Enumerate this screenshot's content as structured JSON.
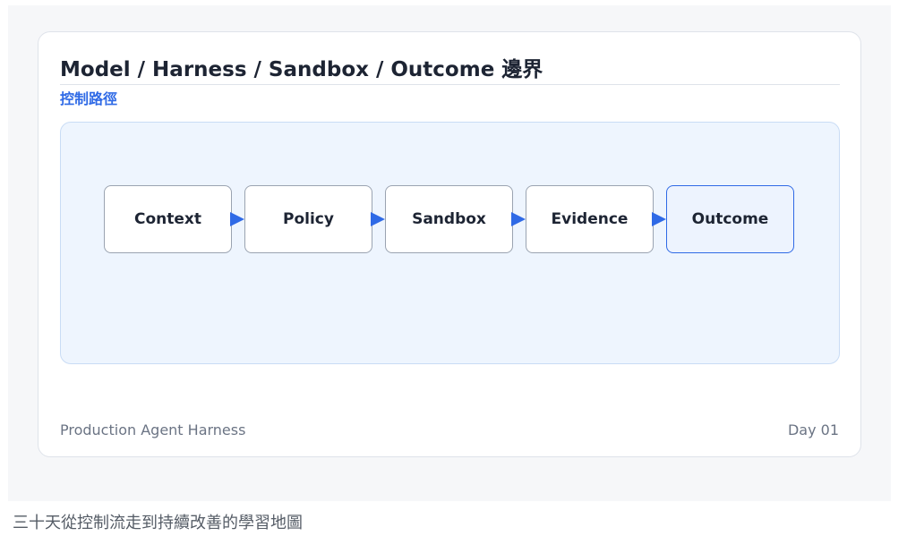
{
  "diagram": {
    "title": "Model / Harness / Sandbox / Outcome 邊界",
    "subtitle": "控制路徑",
    "nodes": [
      {
        "label": "Context",
        "highlight": false
      },
      {
        "label": "Policy",
        "highlight": false
      },
      {
        "label": "Sandbox",
        "highlight": false
      },
      {
        "label": "Evidence",
        "highlight": false
      },
      {
        "label": "Outcome",
        "highlight": true
      }
    ],
    "footer_left": "Production Agent Harness",
    "footer_right": "Day 01"
  },
  "caption": "三十天從控制流走到持續改善的學習地圖",
  "colors": {
    "accent": "#2f6ae6",
    "panel": "#eef5fe",
    "arrow": "#2f6ae6"
  }
}
